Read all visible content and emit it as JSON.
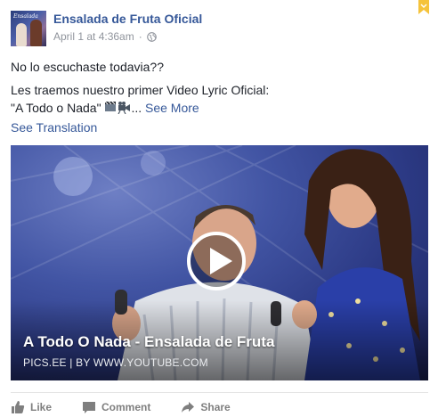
{
  "post": {
    "page_name": "Ensalada de Fruta Oficial",
    "timestamp": "April 1 at 4:36am",
    "separator": "·",
    "avatar_text": "Ensalada",
    "message_line1": "No lo escuchaste todavia??",
    "message_line2": "Les traemos nuestro primer Video Lyric Oficial:",
    "message_line3": "\"A Todo o Nada\"",
    "ellipsis": "...",
    "see_more": "See More",
    "see_translation": "See Translation"
  },
  "video": {
    "title": "A Todo O Nada - Ensalada de Fruta",
    "source": "PICS.EE | BY WWW.YOUTUBE.COM"
  },
  "actions": {
    "like": "Like",
    "comment": "Comment",
    "share": "Share"
  },
  "colors": {
    "link": "#365899",
    "meta": "#90949c",
    "action": "#7f7f7f",
    "bookmark": "#f5c33b"
  },
  "icons": [
    "globe-icon",
    "bookmark-icon",
    "camera-emoji-icon",
    "play-icon",
    "like-icon",
    "comment-icon",
    "share-icon"
  ]
}
